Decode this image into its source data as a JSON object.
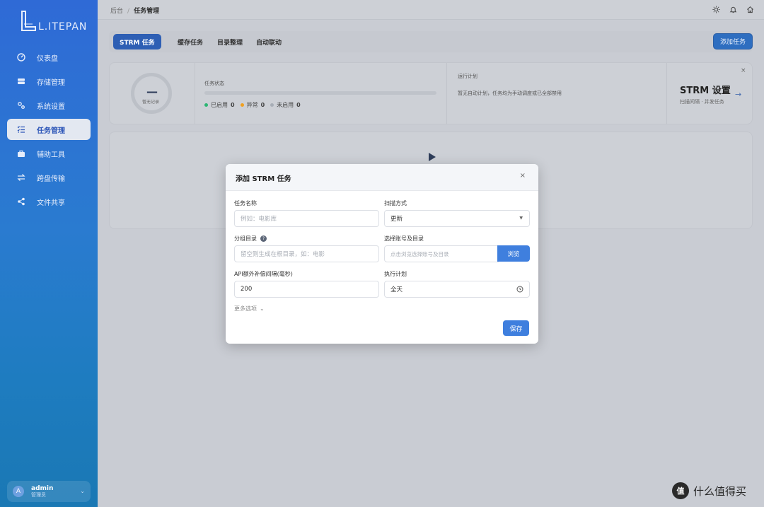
{
  "app": {
    "logo_text": "L.ITEPAN",
    "accent": "#2e5fb4"
  },
  "sidebar": {
    "items": [
      {
        "label": "仪表盘",
        "icon": "dashboard-icon"
      },
      {
        "label": "存储管理",
        "icon": "storage-icon"
      },
      {
        "label": "系统设置",
        "icon": "settings-icon"
      },
      {
        "label": "任务管理",
        "icon": "task-list-icon",
        "active": true
      },
      {
        "label": "辅助工具",
        "icon": "toolbox-icon"
      },
      {
        "label": "跨盘传输",
        "icon": "transfer-icon"
      },
      {
        "label": "文件共享",
        "icon": "share-icon"
      }
    ],
    "user": {
      "avatar": "A",
      "name": "admin",
      "role": "管理员"
    }
  },
  "topbar": {
    "breadcrumb": [
      "后台",
      "任务管理"
    ],
    "icons": [
      "sun-icon",
      "bell-icon",
      "home-icon"
    ]
  },
  "tabs": {
    "items": [
      "STRM 任务",
      "缓存任务",
      "目录整理",
      "自动联动"
    ],
    "active_index": 0,
    "add_label": "添加任务"
  },
  "stats": {
    "ring_value": "—",
    "ring_sub": "暂无记录",
    "status_title": "任务状态",
    "legend": [
      {
        "label": "已启用",
        "count": "0",
        "color": "#2bb673"
      },
      {
        "label": "异常",
        "count": "0",
        "color": "#f0a020"
      },
      {
        "label": "未启用",
        "count": "0",
        "color": "#a7adb6"
      }
    ],
    "plan_title": "运行计划",
    "plan_text": "暂无自动计划，任务均为手动调度或已全部禁用",
    "strm_title": "STRM 设置",
    "strm_sub": "扫描间隔 · 并发任务",
    "close": "×"
  },
  "modal": {
    "title": "添加 STRM 任务",
    "close": "×",
    "fields": {
      "task_name": {
        "label": "任务名称",
        "placeholder": "例如：电影库"
      },
      "scan_mode": {
        "label": "扫描方式",
        "value": "更新"
      },
      "group_dir": {
        "label": "分组目录",
        "placeholder": "留空则生成在根目录，如：电影"
      },
      "account_dir": {
        "label": "选择账号及目录",
        "placeholder": "点击浏览选择账号及目录",
        "browse": "浏览"
      },
      "api_interval": {
        "label": "API额外补偿间隔(毫秒)",
        "value": "200"
      },
      "schedule": {
        "label": "执行计划",
        "value": "全天"
      }
    },
    "more": "更多选项",
    "save": "保存"
  },
  "watermark": {
    "symbol": "值",
    "text": "什么值得买"
  }
}
